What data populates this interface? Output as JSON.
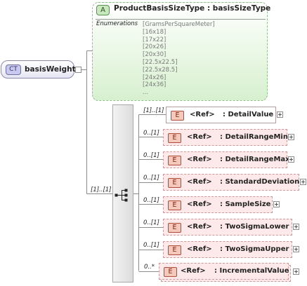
{
  "attribute": {
    "badge": "A",
    "title": "ProductBasisSizeType  : basisSizeType",
    "enumerations_label": "Enumerations",
    "enumerations": [
      "[GramsPerSquareMeter]",
      "[16x18]",
      "[17x22]",
      "[20x26]",
      "[20x30]",
      "[22.5x22.5]",
      "[22.5x28.5]",
      "[24x26]",
      "[24x36]",
      "..."
    ]
  },
  "complex_type": {
    "badge": "CT",
    "name": "basisWeight"
  },
  "sequence": {
    "cardinality": "[1]..[1]"
  },
  "elements": [
    {
      "card": "[1]..[1]",
      "badge": "E",
      "ref": "<Ref>",
      "name": ": DetailValue",
      "optional": false
    },
    {
      "card": "0..[1]",
      "badge": "E",
      "ref": "<Ref>",
      "name": ": DetailRangeMin",
      "optional": true
    },
    {
      "card": "0..[1]",
      "badge": "E",
      "ref": "<Ref>",
      "name": ": DetailRangeMax",
      "optional": true
    },
    {
      "card": "0..[1]",
      "badge": "E",
      "ref": "<Ref>",
      "name": ": StandardDeviation",
      "optional": true
    },
    {
      "card": "0..[1]",
      "badge": "E",
      "ref": "<Ref>",
      "name": ": SampleSize",
      "optional": true
    },
    {
      "card": "0..[1]",
      "badge": "E",
      "ref": "<Ref>",
      "name": ": TwoSigmaLower",
      "optional": true
    },
    {
      "card": "0..[1]",
      "badge": "E",
      "ref": "<Ref>",
      "name": ": TwoSigmaUpper",
      "optional": true
    },
    {
      "card": "0..*",
      "badge": "E",
      "ref": "<Ref>",
      "name": ": IncrementalValue",
      "optional": true
    }
  ]
}
